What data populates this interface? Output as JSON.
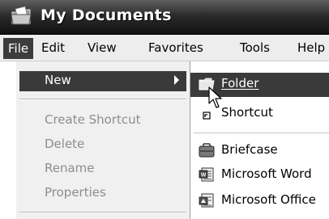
{
  "window": {
    "title": "My Documents"
  },
  "menubar": {
    "file": "File",
    "edit": "Edit",
    "view": "View",
    "favorites": "Favorites",
    "tools": "Tools",
    "help": "Help"
  },
  "file_menu": {
    "new": "New",
    "create_shortcut": "Create Shortcut",
    "delete": "Delete",
    "rename": "Rename",
    "properties": "Properties"
  },
  "new_submenu": {
    "folder": "Folder",
    "shortcut": "Shortcut",
    "briefcase": "Briefcase",
    "word": "Microsoft Word",
    "office": "Microsoft Office"
  },
  "icons": {
    "title": "documents-folder-icon",
    "folder": "folder-icon",
    "shortcut": "shortcut-icon",
    "briefcase": "briefcase-icon",
    "word": "word-document-icon",
    "office": "office-document-icon",
    "cursor": "mouse-pointer-icon"
  },
  "colors": {
    "highlight": "#3a3a3a",
    "disabled_text": "#8d8d8d"
  }
}
